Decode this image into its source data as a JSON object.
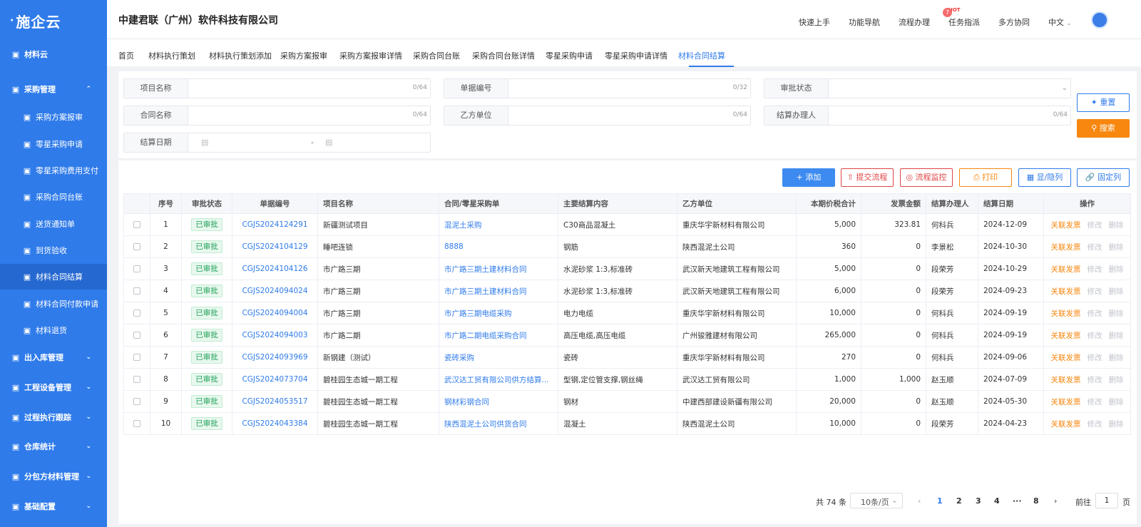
{
  "app": {
    "logo": "施企云",
    "company": "中建君联（广州）软件科技有限公司"
  },
  "header": {
    "nav": [
      "快速上手",
      "功能导航",
      "流程办理",
      "任务指派",
      "多方协同",
      "中文"
    ],
    "hot_tag": "HOT",
    "flow_badge": "7"
  },
  "sidebar": {
    "items": [
      {
        "label": "材料云",
        "level": "top",
        "icon": "grid-icon"
      },
      {
        "label": "采购管理",
        "level": "top",
        "icon": "cart-icon",
        "chev": "up"
      },
      {
        "label": "采购方案报审",
        "level": "sub",
        "icon": "doc-icon"
      },
      {
        "label": "零星采购申请",
        "level": "sub",
        "icon": "doc-icon"
      },
      {
        "label": "零星采购费用支付",
        "level": "sub",
        "icon": "doc-icon"
      },
      {
        "label": "采购合同台账",
        "level": "sub",
        "icon": "doc-icon"
      },
      {
        "label": "送货通知单",
        "level": "sub",
        "icon": "doc-icon"
      },
      {
        "label": "到货验收",
        "level": "sub",
        "icon": "check-icon"
      },
      {
        "label": "材料合同结算",
        "level": "sub",
        "icon": "doc-icon",
        "active": true
      },
      {
        "label": "材料合同付款申请",
        "level": "sub",
        "icon": "doc-icon"
      },
      {
        "label": "材料退货",
        "level": "sub",
        "icon": "return-icon"
      },
      {
        "label": "出入库管理",
        "level": "top",
        "icon": "box-icon",
        "chev": "down"
      },
      {
        "label": "工程设备管理",
        "level": "top",
        "icon": "cube-icon",
        "chev": "down"
      },
      {
        "label": "过程执行跟踪",
        "level": "top",
        "icon": "track-icon",
        "chev": "down"
      },
      {
        "label": "仓库统计",
        "level": "top",
        "icon": "stats-icon",
        "chev": "down"
      },
      {
        "label": "分包方材料管理",
        "level": "top",
        "icon": "sub-icon",
        "chev": "down"
      },
      {
        "label": "基础配置",
        "level": "top",
        "icon": "config-icon",
        "chev": "down"
      }
    ]
  },
  "tabs": [
    "首页",
    "材料执行策划",
    "材料执行策划添加",
    "采购方案报审",
    "采购方案报审详情",
    "采购合同台账",
    "采购合同台账详情",
    "零星采购申请",
    "零星采购申请详情",
    "材料合同结算"
  ],
  "filters": {
    "project_name": {
      "label": "项目名称",
      "count": "0/64"
    },
    "doc_no": {
      "label": "单据编号",
      "count": "0/32"
    },
    "approval_status": {
      "label": "审批状态"
    },
    "contract_name": {
      "label": "合同名称",
      "count": "0/64"
    },
    "party_b": {
      "label": "乙方单位",
      "count": "0/64"
    },
    "handler": {
      "label": "结算办理人",
      "count": "0/64"
    },
    "settle_date": {
      "label": "结算日期",
      "sep": "-"
    },
    "reset_label": "重置",
    "search_label": "搜索"
  },
  "toolbar": {
    "add": "添加",
    "submit_flow": "提交流程",
    "flow_monitor": "流程监控",
    "print": "打印",
    "show_hide": "显/隐列",
    "fix_col": "固定列"
  },
  "table": {
    "headers": [
      "序号",
      "审批状态",
      "单据编号",
      "项目名称",
      "合同/零星采购单",
      "主要结算内容",
      "乙方单位",
      "本期价税合计",
      "发票金额",
      "结算办理人",
      "结算日期",
      "操作"
    ],
    "op_labels": {
      "invoice": "关联发票",
      "edit": "修改",
      "delete": "删除"
    },
    "rows": [
      {
        "no": "1",
        "status": "已审批",
        "code": "CGJS2024124291",
        "project": "新疆测试项目",
        "contract": "混泥土采购",
        "content": "C30商品混凝土",
        "party": "重庆华宇新材料有限公司",
        "total": "5,000",
        "invoice": "323.81",
        "handler": "何科兵",
        "date": "2024-12-09"
      },
      {
        "no": "2",
        "status": "已审批",
        "code": "CGJS2024104129",
        "project": "睡吧连锁",
        "contract": "8888",
        "content": "钢筋",
        "party": "陕西混泥土公司",
        "total": "360",
        "invoice": "0",
        "handler": "李景松",
        "date": "2024-10-30"
      },
      {
        "no": "3",
        "status": "已审批",
        "code": "CGJS2024104126",
        "project": "市广路三期",
        "contract": "市广路三期土建材料合同",
        "content": "水泥砂浆 1:3,标准砖",
        "party": "武汉新天地建筑工程有限公司",
        "total": "5,000",
        "invoice": "0",
        "handler": "段荣芳",
        "date": "2024-10-29"
      },
      {
        "no": "4",
        "status": "已审批",
        "code": "CGJS2024094024",
        "project": "市广路三期",
        "contract": "市广路三期土建材料合同",
        "content": "水泥砂浆 1:3,标准砖",
        "party": "武汉新天地建筑工程有限公司",
        "total": "6,000",
        "invoice": "0",
        "handler": "段荣芳",
        "date": "2024-09-23"
      },
      {
        "no": "5",
        "status": "已审批",
        "code": "CGJS2024094004",
        "project": "市广路三期",
        "contract": "市广路三期电缆采购",
        "content": "电力电缆",
        "party": "重庆华宇新材料有限公司",
        "total": "10,000",
        "invoice": "0",
        "handler": "何科兵",
        "date": "2024-09-19"
      },
      {
        "no": "6",
        "status": "已审批",
        "code": "CGJS2024094003",
        "project": "市广路二期",
        "contract": "市广路二期电缆采购合同",
        "content": "高压电缆,高压电缆",
        "party": "广州骏雅建材有限公司",
        "total": "265,000",
        "invoice": "0",
        "handler": "何科兵",
        "date": "2024-09-19"
      },
      {
        "no": "7",
        "status": "已审批",
        "code": "CGJS2024093969",
        "project": "新钢建（测试）",
        "contract": "瓷砖采购",
        "content": "瓷砖",
        "party": "重庆华宇新材料有限公司",
        "total": "270",
        "invoice": "0",
        "handler": "何科兵",
        "date": "2024-09-06"
      },
      {
        "no": "8",
        "status": "已审批",
        "code": "CGJS2024073704",
        "project": "碧桂园生态城一期工程",
        "contract": "武汉达工贸有限公司供方结算...",
        "content": "型钢,定位管支撑,钢丝绳",
        "party": "武汉达工贸有限公司",
        "total": "1,000",
        "invoice": "1,000",
        "handler": "赵玉顺",
        "date": "2024-07-09"
      },
      {
        "no": "9",
        "status": "已审批",
        "code": "CGJS2024053517",
        "project": "碧桂园生态城一期工程",
        "contract": "钢材彩钢合同",
        "content": "钢材",
        "party": "中建西部建设新疆有限公司",
        "total": "20,000",
        "invoice": "0",
        "handler": "赵玉顺",
        "date": "2024-05-30"
      },
      {
        "no": "10",
        "status": "已审批",
        "code": "CGJS2024043384",
        "project": "碧桂园生态城一期工程",
        "contract": "陕西混泥土公司供货合同",
        "content": "混凝土",
        "party": "陕西混泥土公司",
        "total": "10,000",
        "invoice": "0",
        "handler": "段荣芳",
        "date": "2024-04-23"
      }
    ]
  },
  "pagination": {
    "total": "共 74 条",
    "page_size": "10条/页",
    "pages": [
      "1",
      "2",
      "3",
      "4",
      "···",
      "8"
    ],
    "current": "1",
    "goto_label": "前往",
    "goto_value": "1",
    "page_unit": "页"
  },
  "colors": {
    "primary": "#2f7bea",
    "orange": "#f7870f",
    "red": "#e04545",
    "green": "#22a35a"
  }
}
